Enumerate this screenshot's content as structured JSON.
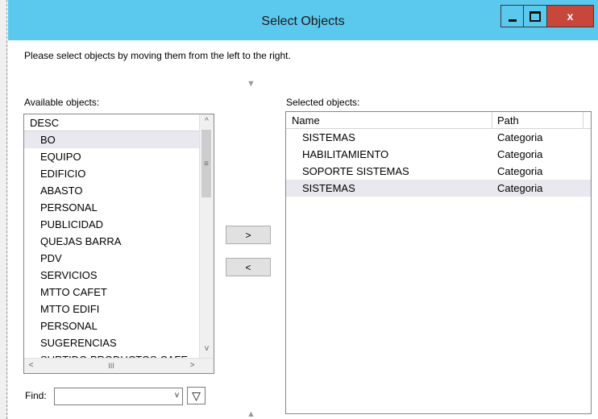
{
  "window": {
    "title": "Select Objects",
    "close_glyph": "x"
  },
  "instruction": "Please select objects by moving them from the left to the right.",
  "available": {
    "label": "Available objects:",
    "column": "DESC",
    "items": [
      "BO",
      "EQUIPO",
      "EDIFICIO",
      "ABASTO",
      "PERSONAL",
      "PUBLICIDAD",
      "QUEJAS BARRA",
      "PDV",
      "SERVICIOS",
      "MTTO CAFET",
      "MTTO EDIFI",
      "PERSONAL",
      "SUGERENCIAS",
      "SURTIDO PRODUCTOS CAFE"
    ],
    "selected_index": 0
  },
  "selected": {
    "label": "Selected objects:",
    "columns": [
      "Name",
      "Path"
    ],
    "rows": [
      {
        "name": "SISTEMAS",
        "path": "Categoria"
      },
      {
        "name": "HABILITAMIENTO",
        "path": "Categoria"
      },
      {
        "name": "SOPORTE SISTEMAS",
        "path": "Categoria"
      },
      {
        "name": "SISTEMAS",
        "path": "Categoria"
      }
    ],
    "selected_index": 3
  },
  "buttons": {
    "add": ">",
    "remove": "<"
  },
  "find": {
    "label": "Find:",
    "value": ""
  },
  "icons": {
    "item_icon": "red-cube-icon",
    "filter": "filter-icon",
    "combo_caret": "chevron-down-icon"
  },
  "glyphs": {
    "up": "^",
    "down": "v",
    "left": "<",
    "right": ">",
    "grip_v": "≡",
    "grip_h": "III",
    "filter": "▽",
    "splitter_down": "▼",
    "splitter_up": "▲"
  }
}
